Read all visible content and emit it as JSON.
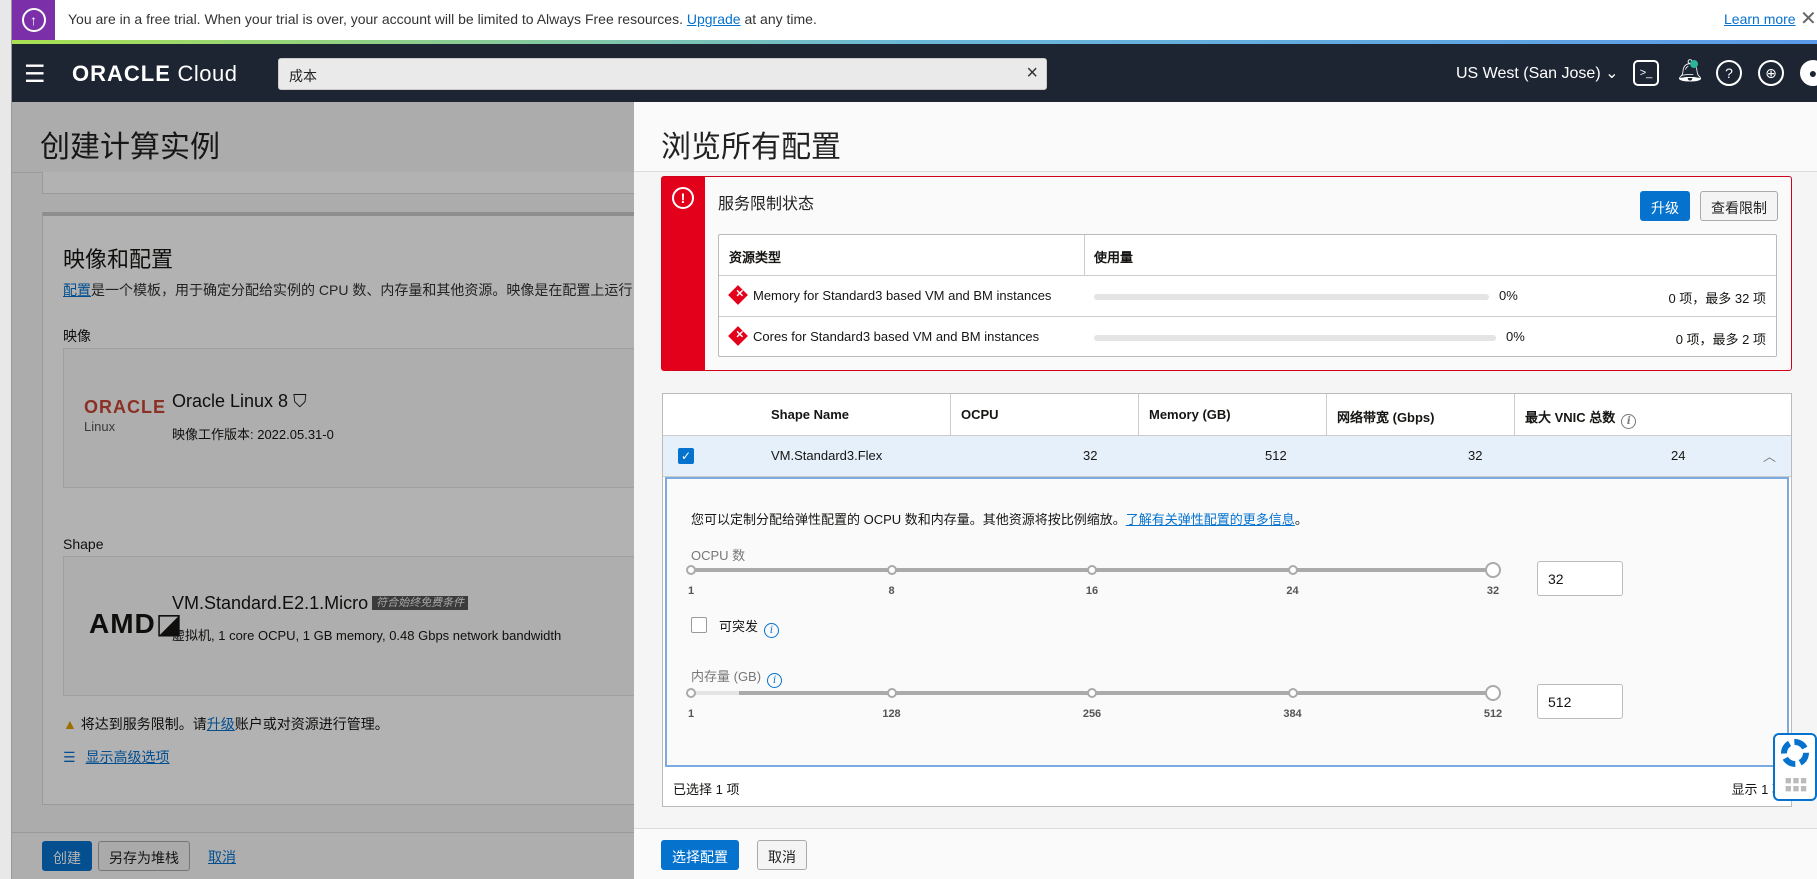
{
  "banner": {
    "text": "You are in a free trial. When your trial is over, your account will be limited to Always Free resources.",
    "link": "Upgrade",
    "suffix": " at any time.",
    "learn_more": "Learn more"
  },
  "nav": {
    "brand_bold": "ORACLE",
    "brand_light": "Cloud",
    "search_value": "成本",
    "region": "US West (San Jose)"
  },
  "left": {
    "title": "创建计算实例",
    "section_title": "映像和配置",
    "desc_link": "配置",
    "desc": "是一个模板，用于确定分配给实例的 CPU 数、内存量和其他资源。映像是在配置上运行",
    "image_label": "映像",
    "image_logo": "ORACLE",
    "image_logo_sub": "Linux",
    "image_name": "Oracle Linux 8",
    "image_version": "映像工作版本: 2022.05.31-0",
    "shape_label": "Shape",
    "shape_logo": "AMD",
    "shape_name": "VM.Standard.E2.1.Micro",
    "shape_badge": "符合始终免费条件",
    "shape_desc": "虚拟机, 1 core OCPU, 1 GB memory, 0.48 Gbps network bandwidth",
    "warn_pre": "将达到服务限制。请",
    "warn_link": "升级",
    "warn_post": "账户或对资源进行管理。",
    "advanced": "显示高级选项",
    "create": "创建",
    "save_stack": "另存为堆栈",
    "cancel": "取消"
  },
  "drawer": {
    "title": "浏览所有配置",
    "alert": {
      "title": "服务限制状态",
      "upgrade": "升级",
      "view_limits": "查看限制",
      "col_resource": "资源类型",
      "col_usage": "使用量",
      "rows": [
        {
          "name": "Memory for Standard3 based VM and BM instances",
          "percent": "0%",
          "count": "0 项，最多 32 项",
          "fraction": 0
        },
        {
          "name": "Cores for Standard3 based VM and BM instances",
          "percent": "0%",
          "count": "0 项，最多 2 项",
          "fraction": 0
        }
      ]
    },
    "table": {
      "headers": [
        "Shape Name",
        "OCPU",
        "Memory (GB)",
        "网络带宽 (Gbps)",
        "最大 VNIC 总数"
      ],
      "row": {
        "name": "VM.Standard3.Flex",
        "ocpu": "32",
        "memory": "512",
        "bandwidth": "32",
        "vnic": "24",
        "checked": true
      },
      "flex_desc": "您可以定制分配给弹性配置的 OCPU 数和内存量。其他资源将按比例缩放。",
      "flex_link": "了解有关弹性配置的更多信息",
      "flex_end": "。",
      "ocpu_label": "OCPU 数",
      "ocpu_ticks": [
        "1",
        "8",
        "16",
        "24",
        "32"
      ],
      "ocpu_value": "32",
      "ocpu_min": 1,
      "ocpu_max": 32,
      "burst_label": "可突发",
      "burst_checked": false,
      "mem_label": "内存量 (GB)",
      "mem_ticks": [
        "1",
        "128",
        "256",
        "384",
        "512"
      ],
      "mem_value": "512",
      "mem_min": 1,
      "mem_max": 512,
      "selected": "已选择 1 项",
      "showing": "显示 1 项"
    },
    "select": "选择配置",
    "cancel": "取消"
  }
}
